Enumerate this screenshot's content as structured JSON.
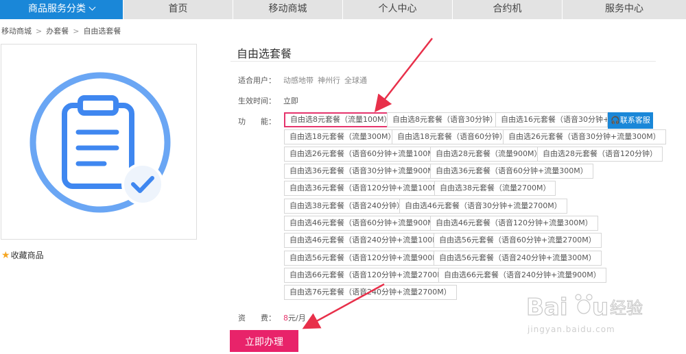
{
  "nav": {
    "category_label": "商品服务分类",
    "items": [
      "首页",
      "移动商城",
      "个人中心",
      "合约机",
      "服务中心"
    ]
  },
  "breadcrumb": [
    "移动商城",
    "办套餐",
    "自由选套餐"
  ],
  "favorite_label": "收藏商品",
  "product": {
    "title": "自由选套餐",
    "users_label": "适合用户：",
    "users": [
      "动感地带",
      "神州行",
      "全球通"
    ],
    "effective_label": "生效时间：",
    "effective_value": "立即",
    "function_label": "功　　能：",
    "options": [
      "自由选8元套餐（流量100M）",
      "自由选8元套餐（语音30分钟）",
      "自由选16元套餐（语音30分钟+流量",
      "自由选18元套餐（流量300M）",
      "自由选18元套餐（语音60分钟）",
      "自由选26元套餐（语音30分钟+流量300M）",
      "自由选26元套餐（语音60分钟+流量100M）",
      "自由选28元套餐（流量900M）",
      "自由选28元套餐（语音120分钟）",
      "自由选36元套餐（语音30分钟+流量900M）",
      "自由选36元套餐（语音60分钟+流量300M）",
      "自由选36元套餐（语音120分钟+流量100M）",
      "自由选38元套餐（流量2700M）",
      "自由选38元套餐（语音240分钟）",
      "自由选46元套餐（语音30分钟+流量2700M）",
      "自由选46元套餐（语音60分钟+流量900M）",
      "自由选46元套餐（语音120分钟+流量300M）",
      "自由选46元套餐（语音240分钟+流量100M）",
      "自由选56元套餐（语音60分钟+流量2700M）",
      "自由选56元套餐（语音120分钟+流量900M）",
      "自由选56元套餐（语音240分钟+流量300M）",
      "自由选66元套餐（语音120分钟+流量2700M）",
      "自由选66元套餐（语音240分钟+流量900M）",
      "自由选76元套餐（语音240分钟+流量2700M）"
    ],
    "selected_index": 0,
    "fee_label": "资　　费：",
    "fee_number": "8",
    "fee_unit": "元/月",
    "buy_label": "立即办理"
  },
  "customer_service_label": "联系客服",
  "watermark": {
    "brand": "Baidu经验",
    "url": "jingyan.baidu.com"
  },
  "colors": {
    "nav_accent": "#1a87d8",
    "primary": "#e8236a",
    "selected_border": "#e5336b",
    "annotation_arrow": "#e8304a"
  }
}
